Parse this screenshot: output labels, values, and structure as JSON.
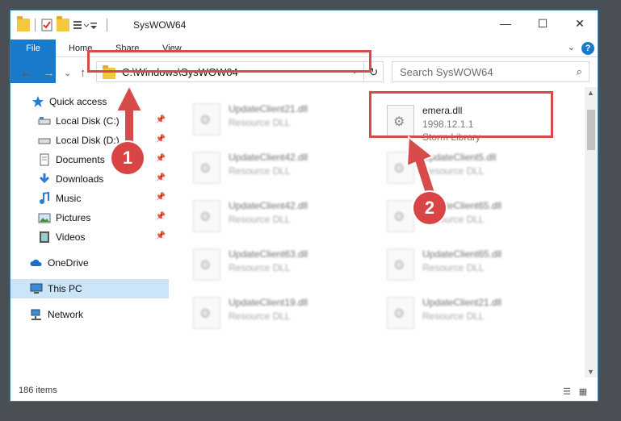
{
  "window": {
    "title": "SysWOW64",
    "minimize": "—",
    "maximize": "☐",
    "close": "✕"
  },
  "ribbon": {
    "tabs": [
      "File",
      "Home",
      "Share",
      "View"
    ],
    "help": "?",
    "expand": "⌄"
  },
  "nav": {
    "back": "←",
    "forward": "→",
    "recent": "⌄",
    "up": "↑",
    "address": "C:\\Windows\\SysWOW64",
    "address_dropdown": "⌄",
    "refresh": "↻",
    "search_placeholder": "Search SysWOW64",
    "search_icon": "⌕"
  },
  "sidebar": {
    "items": [
      {
        "label": "Quick access",
        "icon": "star-icon"
      },
      {
        "label": "Local Disk (C:)",
        "icon": "drive-icon",
        "pin": "📌"
      },
      {
        "label": "Local Disk (D:)",
        "icon": "drive-icon",
        "pin": "📌"
      },
      {
        "label": "Documents",
        "icon": "documents-icon",
        "pin": "📌"
      },
      {
        "label": "Downloads",
        "icon": "download-icon",
        "pin": "📌"
      },
      {
        "label": "Music",
        "icon": "music-icon",
        "pin": "📌"
      },
      {
        "label": "Pictures",
        "icon": "pictures-icon",
        "pin": "📌"
      },
      {
        "label": "Videos",
        "icon": "video-icon",
        "pin": "📌"
      },
      {
        "label": "OneDrive",
        "icon": "cloud-icon"
      },
      {
        "label": "This PC",
        "icon": "computer-icon"
      },
      {
        "label": "Network",
        "icon": "network-icon"
      }
    ]
  },
  "files": {
    "featured": {
      "name": "emera.dll",
      "version": "1998.12.1.1",
      "description": "Storm Library"
    },
    "left": [
      {
        "name": "UpdateClient21.dll",
        "type": "Resource DLL"
      },
      {
        "name": "UpdateClient42.dll",
        "type": "Resource DLL"
      },
      {
        "name": "UpdateClient42.dll",
        "type": "Resource DLL"
      },
      {
        "name": "UpdateClient63.dll",
        "type": "Resource DLL"
      },
      {
        "name": "UpdateClient19.dll",
        "type": "Resource DLL"
      }
    ],
    "right": [
      {
        "name": "UpdateClient5.dll",
        "type": "Resource DLL"
      },
      {
        "name": "UpdateClient65.dll",
        "type": "Resource DLL"
      },
      {
        "name": "UpdateClient65.dll",
        "type": "Resource DLL"
      },
      {
        "name": "UpdateClient21.dll",
        "type": "Resource DLL"
      }
    ]
  },
  "status": {
    "count": "186 items"
  },
  "annotations": {
    "step1": "1",
    "step2": "2",
    "color": "#d84b4b"
  }
}
